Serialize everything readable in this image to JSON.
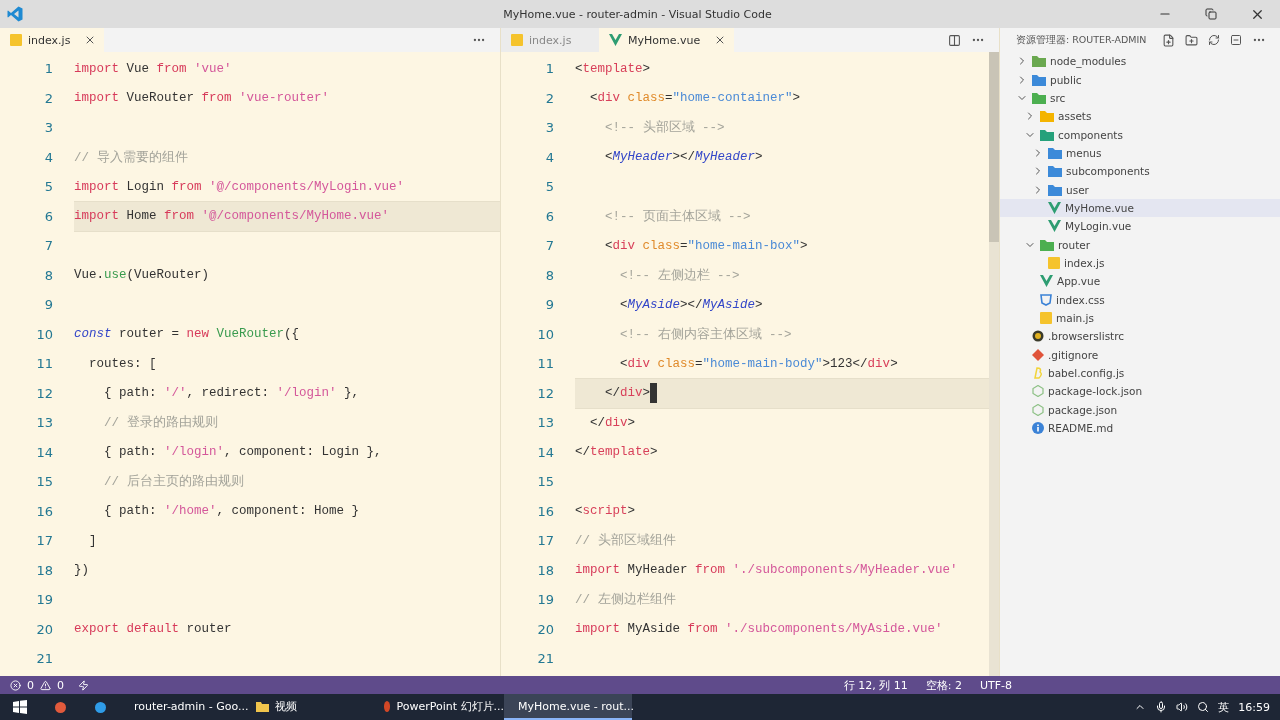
{
  "window": {
    "title": "MyHome.vue - router-admin - Visual Studio Code"
  },
  "editor_groups": [
    {
      "cursor": false,
      "tabs": [
        {
          "label": "index.js",
          "kind": "js",
          "selected": true
        }
      ],
      "lines": [
        {
          "number": "1",
          "current": false,
          "tokens": [
            {
              "kind": "kw",
              "text": "import"
            },
            {
              "kind": "pl",
              "text": " Vue "
            },
            {
              "kind": "kw",
              "text": "from"
            },
            {
              "kind": "str",
              "text": " 'vue'"
            }
          ]
        },
        {
          "number": "2",
          "current": false,
          "tokens": [
            {
              "kind": "kw",
              "text": "import"
            },
            {
              "kind": "pl",
              "text": " VueRouter "
            },
            {
              "kind": "kw",
              "text": "from"
            },
            {
              "kind": "str",
              "text": " 'vue-router'"
            }
          ]
        },
        {
          "number": "3",
          "current": false
        },
        {
          "number": "4",
          "current": false,
          "tokens": [
            {
              "kind": "cm",
              "text": "// 导入需要的组件"
            }
          ]
        },
        {
          "number": "5",
          "current": false,
          "tokens": [
            {
              "kind": "kw",
              "text": "import"
            },
            {
              "kind": "pl",
              "text": " Login "
            },
            {
              "kind": "kw",
              "text": "from"
            },
            {
              "kind": "str",
              "text": " '@/components/MyLogin.vue'"
            }
          ]
        },
        {
          "number": "6",
          "current": true,
          "tokens": [
            {
              "kind": "kw",
              "text": "import"
            },
            {
              "kind": "pl",
              "text": " Home "
            },
            {
              "kind": "kw",
              "text": "from"
            },
            {
              "kind": "str",
              "text": " '@/components/MyHome.vue'"
            }
          ]
        },
        {
          "number": "7",
          "current": false
        },
        {
          "number": "8",
          "current": false,
          "tokens": [
            {
              "kind": "pl",
              "text": "Vue."
            },
            {
              "kind": "fn",
              "text": "use"
            },
            {
              "kind": "pl",
              "text": "(VueRouter)"
            }
          ]
        },
        {
          "number": "9",
          "current": false
        },
        {
          "number": "10",
          "current": false,
          "tokens": [
            {
              "kind": "it",
              "text": "const"
            },
            {
              "kind": "pl",
              "text": " router = "
            },
            {
              "kind": "kw",
              "text": "new"
            },
            {
              "kind": "fn",
              "text": " VueRouter"
            },
            {
              "kind": "pl",
              "text": "({"
            }
          ]
        },
        {
          "number": "11",
          "current": false,
          "tokens": [
            {
              "kind": "pl",
              "text": "  routes: ["
            }
          ]
        },
        {
          "number": "12",
          "current": false,
          "tokens": [
            {
              "kind": "pl",
              "text": "    { path: "
            },
            {
              "kind": "str",
              "text": "'/'"
            },
            {
              "kind": "pl",
              "text": ", redirect: "
            },
            {
              "kind": "str",
              "text": "'/login'"
            },
            {
              "kind": "pl",
              "text": " },"
            }
          ]
        },
        {
          "number": "13",
          "current": false,
          "tokens": [
            {
              "kind": "cm",
              "text": "    // 登录的路由规则"
            }
          ]
        },
        {
          "number": "14",
          "current": false,
          "tokens": [
            {
              "kind": "pl",
              "text": "    { path: "
            },
            {
              "kind": "str",
              "text": "'/login'"
            },
            {
              "kind": "pl",
              "text": ", component: Login },"
            }
          ]
        },
        {
          "number": "15",
          "current": false,
          "tokens": [
            {
              "kind": "cm",
              "text": "    // 后台主页的路由规则"
            }
          ]
        },
        {
          "number": "16",
          "current": false,
          "tokens": [
            {
              "kind": "pl",
              "text": "    { path: "
            },
            {
              "kind": "str",
              "text": "'/home'"
            },
            {
              "kind": "pl",
              "text": ", component: Home }"
            }
          ]
        },
        {
          "number": "17",
          "current": false,
          "tokens": [
            {
              "kind": "pl",
              "text": "  ]"
            }
          ]
        },
        {
          "number": "18",
          "current": false,
          "tokens": [
            {
              "kind": "pl",
              "text": "})"
            }
          ]
        },
        {
          "number": "19",
          "current": false
        },
        {
          "number": "20",
          "current": false,
          "tokens": [
            {
              "kind": "kw",
              "text": "export default"
            },
            {
              "kind": "pl",
              "text": " router"
            }
          ]
        },
        {
          "number": "21",
          "current": false
        }
      ]
    },
    {
      "cursor": true,
      "tabs": [
        {
          "label": "index.js",
          "kind": "js",
          "selected": false
        },
        {
          "label": "MyHome.vue",
          "kind": "vue",
          "selected": true
        }
      ],
      "lines": [
        {
          "number": "1",
          "current": false,
          "tokens": [
            {
              "kind": "pl",
              "text": "<"
            },
            {
              "kind": "tag",
              "text": "template"
            },
            {
              "kind": "pl",
              "text": ">"
            }
          ]
        },
        {
          "number": "2",
          "current": false,
          "tokens": [
            {
              "kind": "pl",
              "text": "  <"
            },
            {
              "kind": "tag",
              "text": "div"
            },
            {
              "kind": "attr",
              "text": " class"
            },
            {
              "kind": "pl",
              "text": "="
            },
            {
              "kind": "val",
              "text": "\"home-container\""
            },
            {
              "kind": "pl",
              "text": ">"
            }
          ]
        },
        {
          "number": "3",
          "current": false,
          "tokens": [
            {
              "kind": "cm",
              "text": "    <!-- 头部区域 -->"
            }
          ]
        },
        {
          "number": "4",
          "current": false,
          "tokens": [
            {
              "kind": "pl",
              "text": "    <"
            },
            {
              "kind": "it",
              "text": "MyHeader"
            },
            {
              "kind": "pl",
              "text": "></"
            },
            {
              "kind": "it",
              "text": "MyHeader"
            },
            {
              "kind": "pl",
              "text": ">"
            }
          ]
        },
        {
          "number": "5",
          "current": false
        },
        {
          "number": "6",
          "current": false,
          "tokens": [
            {
              "kind": "cm",
              "text": "    <!-- 页面主体区域 -->"
            }
          ]
        },
        {
          "number": "7",
          "current": false,
          "tokens": [
            {
              "kind": "pl",
              "text": "    <"
            },
            {
              "kind": "tag",
              "text": "div"
            },
            {
              "kind": "attr",
              "text": " class"
            },
            {
              "kind": "pl",
              "text": "="
            },
            {
              "kind": "val",
              "text": "\"home-main-box\""
            },
            {
              "kind": "pl",
              "text": ">"
            }
          ]
        },
        {
          "number": "8",
          "current": false,
          "tokens": [
            {
              "kind": "cm",
              "text": "      <!-- 左侧边栏 -->"
            }
          ]
        },
        {
          "number": "9",
          "current": false,
          "tokens": [
            {
              "kind": "pl",
              "text": "      <"
            },
            {
              "kind": "it",
              "text": "MyAside"
            },
            {
              "kind": "pl",
              "text": "></"
            },
            {
              "kind": "it",
              "text": "MyAside"
            },
            {
              "kind": "pl",
              "text": ">"
            }
          ]
        },
        {
          "number": "10",
          "current": false,
          "tokens": [
            {
              "kind": "cm",
              "text": "      <!-- 右侧内容主体区域 -->"
            }
          ]
        },
        {
          "number": "11",
          "current": false,
          "tokens": [
            {
              "kind": "pl",
              "text": "      <"
            },
            {
              "kind": "tag",
              "text": "div"
            },
            {
              "kind": "attr",
              "text": " class"
            },
            {
              "kind": "pl",
              "text": "="
            },
            {
              "kind": "val",
              "text": "\"home-main-body\""
            },
            {
              "kind": "pl",
              "text": ">123</"
            },
            {
              "kind": "tag",
              "text": "div"
            },
            {
              "kind": "pl",
              "text": ">"
            }
          ]
        },
        {
          "number": "12",
          "current": true,
          "tokens": [
            {
              "kind": "pl",
              "text": "    </"
            },
            {
              "kind": "tag",
              "text": "div"
            },
            {
              "kind": "pl",
              "text": ">"
            }
          ]
        },
        {
          "number": "13",
          "current": false,
          "tokens": [
            {
              "kind": "pl",
              "text": "  </"
            },
            {
              "kind": "tag",
              "text": "div"
            },
            {
              "kind": "pl",
              "text": ">"
            }
          ]
        },
        {
          "number": "14",
          "current": false,
          "tokens": [
            {
              "kind": "pl",
              "text": "</"
            },
            {
              "kind": "tag",
              "text": "template"
            },
            {
              "kind": "pl",
              "text": ">"
            }
          ]
        },
        {
          "number": "15",
          "current": false
        },
        {
          "number": "16",
          "current": false,
          "tokens": [
            {
              "kind": "pl",
              "text": "<"
            },
            {
              "kind": "tag",
              "text": "script"
            },
            {
              "kind": "pl",
              "text": ">"
            }
          ]
        },
        {
          "number": "17",
          "current": false,
          "tokens": [
            {
              "kind": "cm",
              "text": "// 头部区域组件"
            }
          ]
        },
        {
          "number": "18",
          "current": false,
          "tokens": [
            {
              "kind": "kw",
              "text": "import"
            },
            {
              "kind": "pl",
              "text": " MyHeader "
            },
            {
              "kind": "kw",
              "text": "from"
            },
            {
              "kind": "str",
              "text": " './subcomponents/MyHeader.vue'"
            }
          ]
        },
        {
          "number": "19",
          "current": false,
          "tokens": [
            {
              "kind": "cm",
              "text": "// 左侧边栏组件"
            }
          ]
        },
        {
          "number": "20",
          "current": false,
          "tokens": [
            {
              "kind": "kw",
              "text": "import"
            },
            {
              "kind": "pl",
              "text": " MyAside "
            },
            {
              "kind": "kw",
              "text": "from"
            },
            {
              "kind": "str",
              "text": " './subcomponents/MyAside.vue'"
            }
          ]
        },
        {
          "number": "21",
          "current": false
        }
      ]
    }
  ],
  "explorer": {
    "title": "资源管理器: ROUTER-ADMIN",
    "tree": [
      {
        "label": "node_modules",
        "kind": "folder",
        "color": "#6aa84f",
        "expanded": false,
        "selected": false
      },
      {
        "label": "public",
        "kind": "folder",
        "color": "#3c8ad9",
        "expanded": false,
        "selected": false
      },
      {
        "label": "src",
        "kind": "folder",
        "color": "#4caf50",
        "expanded": true,
        "selected": false,
        "children": [
          {
            "label": "assets",
            "kind": "folder",
            "color": "#f4b400",
            "expanded": false,
            "selected": false
          },
          {
            "label": "components",
            "kind": "folder",
            "color": "#26a17b",
            "expanded": true,
            "selected": false,
            "children": [
              {
                "label": "menus",
                "kind": "folder",
                "color": "#3c8ad9",
                "expanded": false,
                "selected": false
              },
              {
                "label": "subcomponents",
                "kind": "folder",
                "color": "#3c8ad9",
                "expanded": false,
                "selected": false
              },
              {
                "label": "user",
                "kind": "folder",
                "color": "#3c8ad9",
                "expanded": false,
                "selected": false
              },
              {
                "label": "MyHome.vue",
                "kind": "vue",
                "selected": true
              },
              {
                "label": "MyLogin.vue",
                "kind": "vue",
                "selected": false
              }
            ]
          },
          {
            "label": "router",
            "kind": "folder",
            "color": "#4caf50",
            "expanded": true,
            "selected": false,
            "children": [
              {
                "label": "index.js",
                "kind": "js",
                "selected": false
              }
            ]
          },
          {
            "label": "App.vue",
            "kind": "vue",
            "selected": false
          },
          {
            "label": "index.css",
            "kind": "css",
            "selected": false
          },
          {
            "label": "main.js",
            "kind": "js",
            "selected": false
          }
        ]
      },
      {
        "label": ".browserslistrc",
        "kind": "rc",
        "selected": false
      },
      {
        "label": ".gitignore",
        "kind": "git",
        "selected": false
      },
      {
        "label": "babel.config.js",
        "kind": "babel",
        "selected": false
      },
      {
        "label": "package-lock.json",
        "kind": "json",
        "selected": false
      },
      {
        "label": "package.json",
        "kind": "json",
        "selected": false
      },
      {
        "label": "README.md",
        "kind": "info",
        "selected": false
      }
    ]
  },
  "status_bar": {
    "errors": "0",
    "warnings": "0",
    "items": [
      "行 12, 列 11",
      "空格: 2",
      "UTF-8"
    ]
  },
  "taskbar": {
    "apps": [
      {
        "label": "router-admin - Goo...",
        "kind": "chrome",
        "selected": false
      },
      {
        "label": "视频",
        "kind": "folder",
        "selected": false
      },
      {
        "label": "PowerPoint 幻灯片...",
        "kind": "ppt",
        "selected": false
      },
      {
        "label": "MyHome.vue - rout...",
        "kind": "vscode",
        "selected": true
      }
    ],
    "ime": "英",
    "clock": "16:59"
  }
}
